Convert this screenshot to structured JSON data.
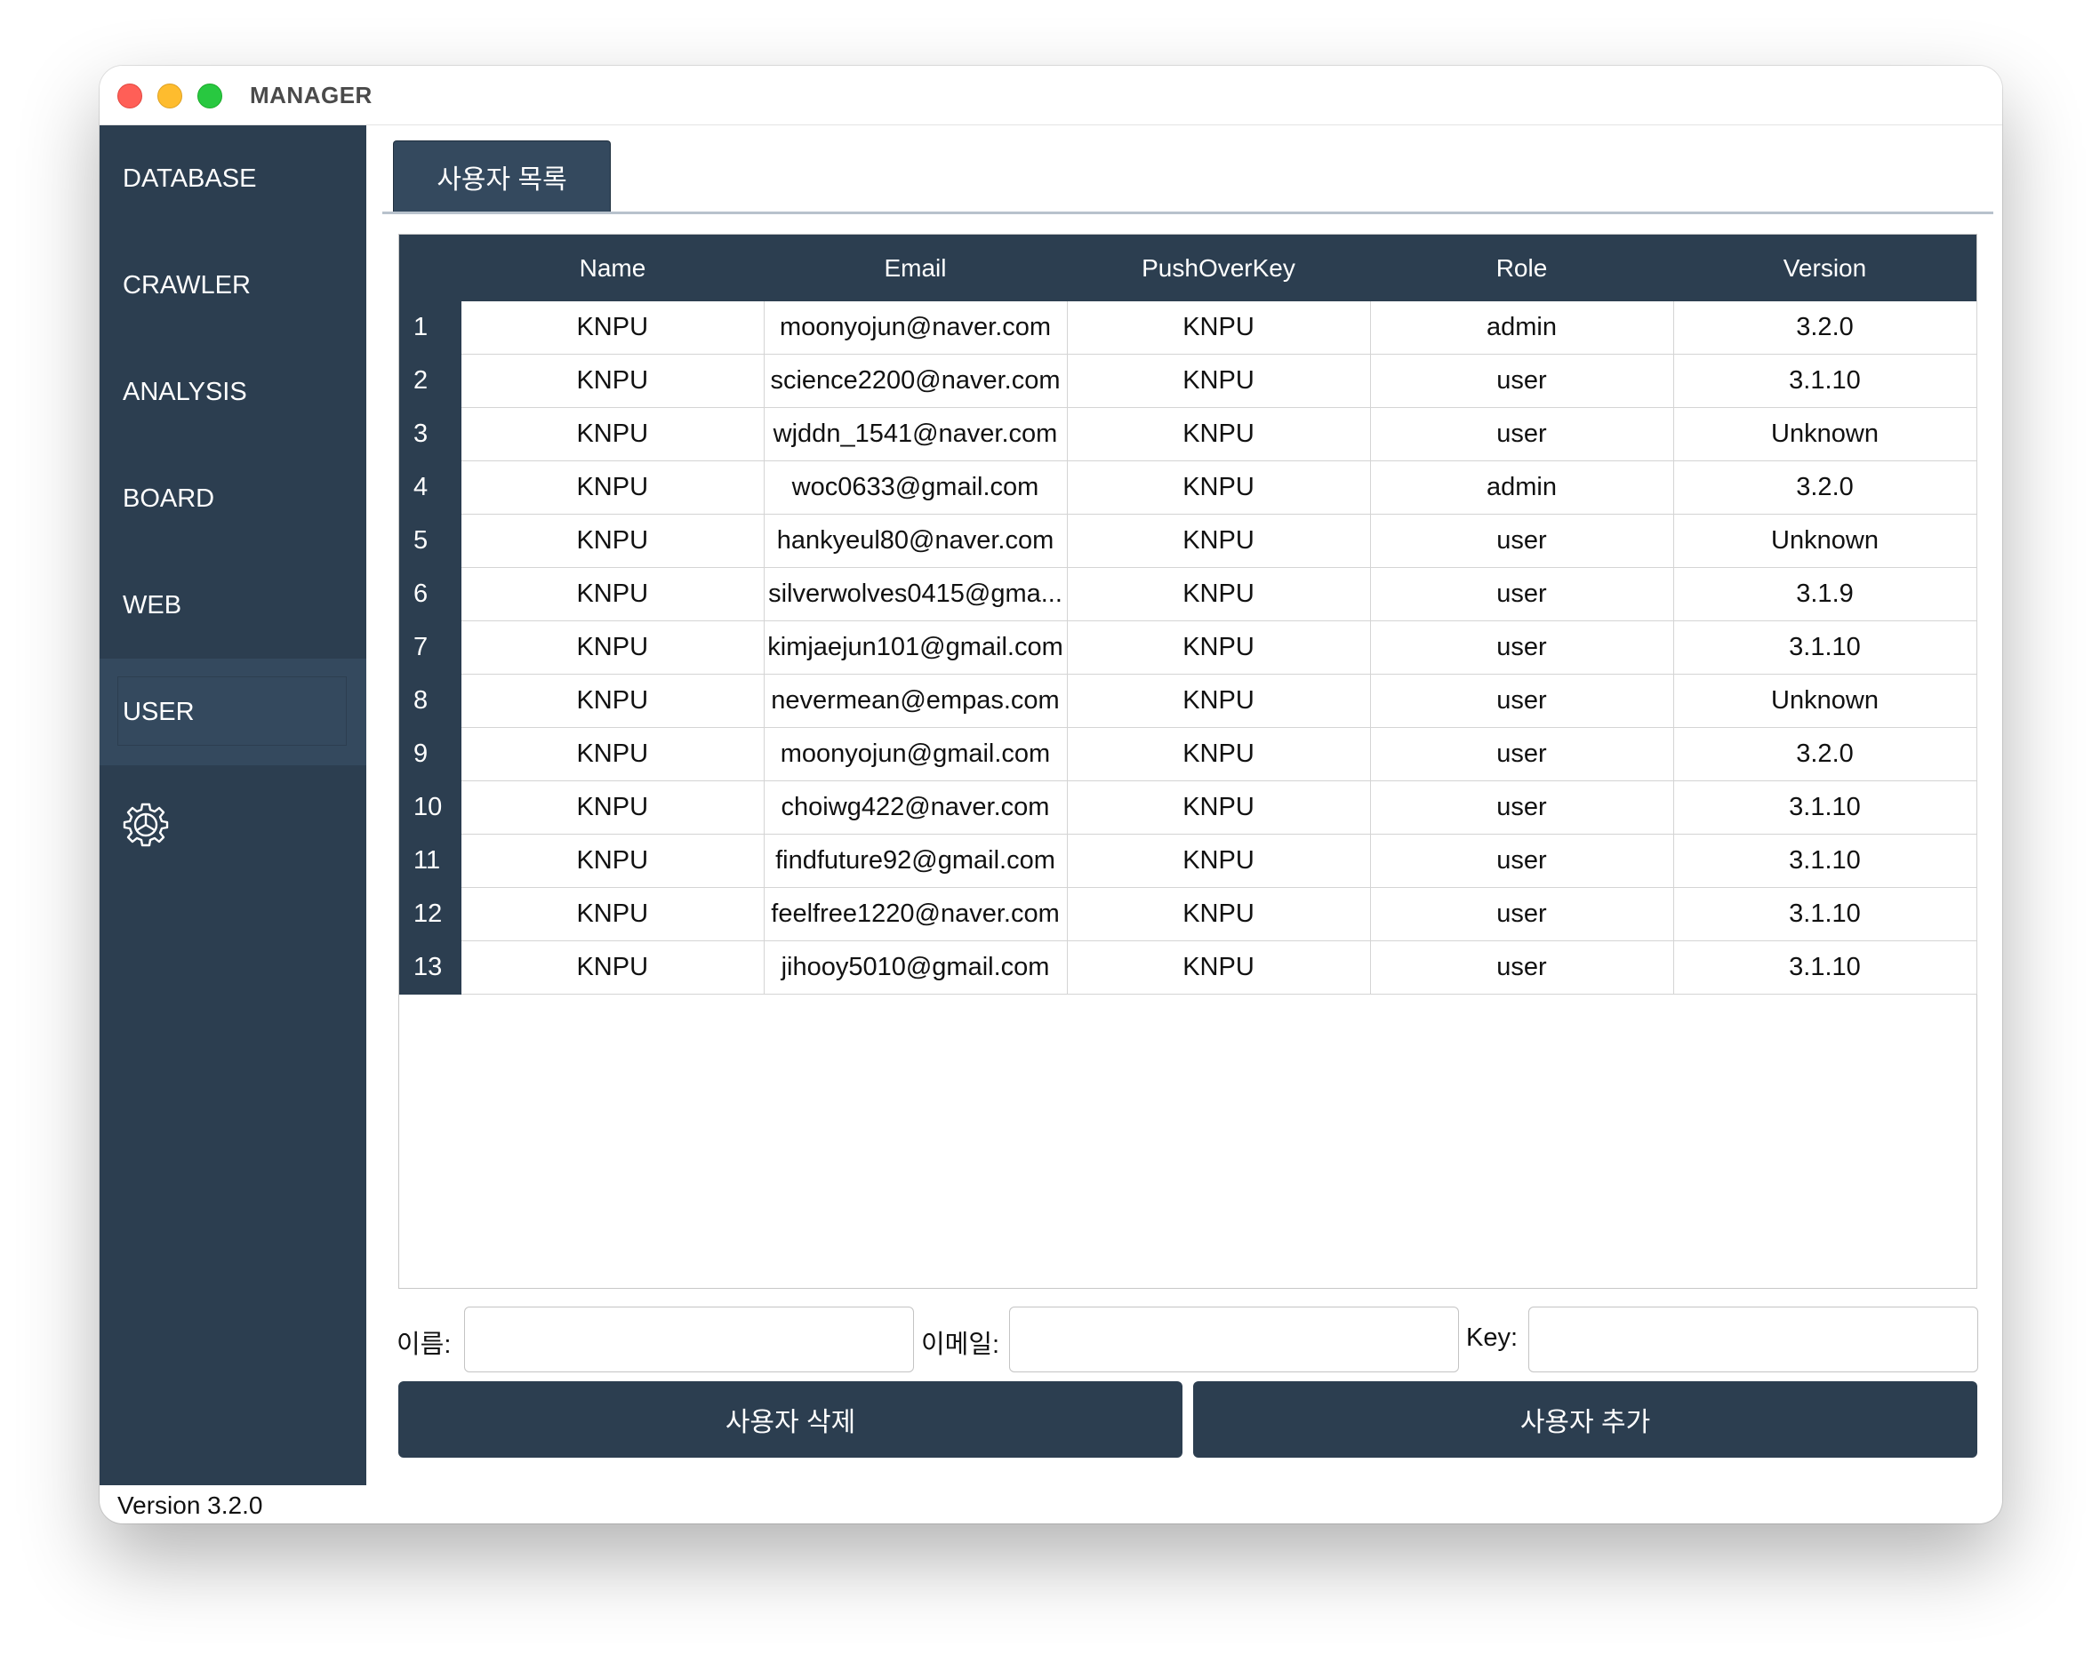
{
  "window": {
    "title": "MANAGER",
    "version_label": "Version 3.2.0"
  },
  "sidebar": {
    "items": [
      {
        "label": "DATABASE"
      },
      {
        "label": "CRAWLER"
      },
      {
        "label": "ANALYSIS"
      },
      {
        "label": "BOARD"
      },
      {
        "label": "WEB"
      },
      {
        "label": "USER",
        "active": true
      }
    ],
    "settings_icon": "gear-icon"
  },
  "tab": {
    "label": "사용자 목록"
  },
  "table": {
    "columns": [
      "Name",
      "Email",
      "PushOverKey",
      "Role",
      "Version"
    ],
    "rows": [
      {
        "num": "1",
        "name": "KNPU",
        "email": "moonyojun@naver.com",
        "key": "KNPU",
        "role": "admin",
        "version": "3.2.0"
      },
      {
        "num": "2",
        "name": "KNPU",
        "email": "science2200@naver.com",
        "key": "KNPU",
        "role": "user",
        "version": "3.1.10"
      },
      {
        "num": "3",
        "name": "KNPU",
        "email": "wjddn_1541@naver.com",
        "key": "KNPU",
        "role": "user",
        "version": "Unknown"
      },
      {
        "num": "4",
        "name": "KNPU",
        "email": "woc0633@gmail.com",
        "key": "KNPU",
        "role": "admin",
        "version": "3.2.0"
      },
      {
        "num": "5",
        "name": "KNPU",
        "email": "hankyeul80@naver.com",
        "key": "KNPU",
        "role": "user",
        "version": "Unknown"
      },
      {
        "num": "6",
        "name": "KNPU",
        "email": "silverwolves0415@gma...",
        "key": "KNPU",
        "role": "user",
        "version": "3.1.9"
      },
      {
        "num": "7",
        "name": "KNPU",
        "email": "kimjaejun101@gmail.com",
        "key": "KNPU",
        "role": "user",
        "version": "3.1.10"
      },
      {
        "num": "8",
        "name": "KNPU",
        "email": "nevermean@empas.com",
        "key": "KNPU",
        "role": "user",
        "version": "Unknown"
      },
      {
        "num": "9",
        "name": "KNPU",
        "email": "moonyojun@gmail.com",
        "key": "KNPU",
        "role": "user",
        "version": "3.2.0"
      },
      {
        "num": "10",
        "name": "KNPU",
        "email": "choiwg422@naver.com",
        "key": "KNPU",
        "role": "user",
        "version": "3.1.10"
      },
      {
        "num": "11",
        "name": "KNPU",
        "email": "findfuture92@gmail.com",
        "key": "KNPU",
        "role": "user",
        "version": "3.1.10"
      },
      {
        "num": "12",
        "name": "KNPU",
        "email": "feelfree1220@naver.com",
        "key": "KNPU",
        "role": "user",
        "version": "3.1.10"
      },
      {
        "num": "13",
        "name": "KNPU",
        "email": "jihooy5010@gmail.com",
        "key": "KNPU",
        "role": "user",
        "version": "3.1.10"
      }
    ]
  },
  "form": {
    "name_label": "이름:",
    "name_value": "",
    "email_label": "이메일:",
    "email_value": "",
    "key_label": "Key:",
    "key_value": ""
  },
  "buttons": {
    "delete_label": "사용자 삭제",
    "add_label": "사용자 추가"
  },
  "colors": {
    "sidebar_bg": "#2c3e50",
    "sidebar_active": "#34495e",
    "header_bg": "#2c3e50"
  }
}
